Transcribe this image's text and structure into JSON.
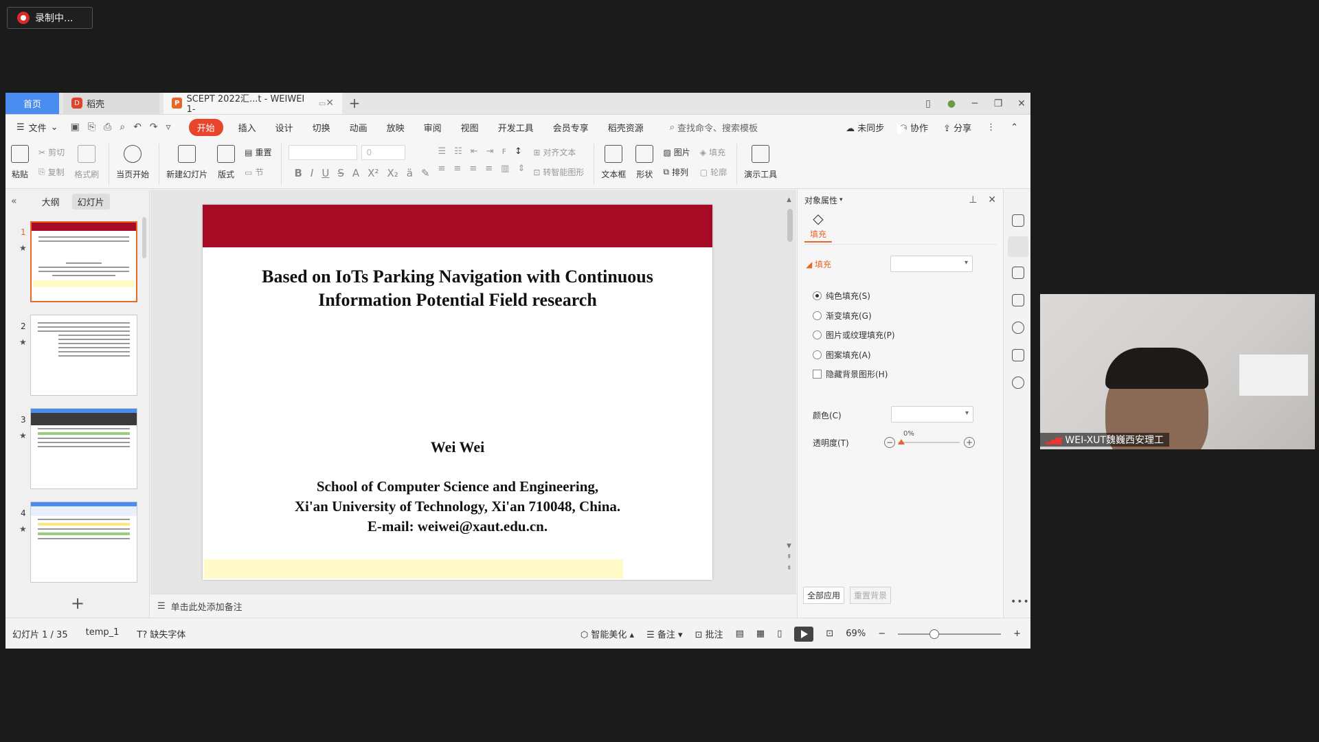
{
  "recording": {
    "label": "录制中..."
  },
  "tabs": {
    "home": "首页",
    "daoke": "稻壳",
    "doc": "SCEPT 2022汇...t - WEIWEI 1-",
    "add": "+"
  },
  "menu": {
    "file": "文件",
    "items": [
      "开始",
      "插入",
      "设计",
      "切换",
      "动画",
      "放映",
      "审阅",
      "视图",
      "开发工具",
      "会员专享",
      "稻壳资源"
    ],
    "active": "开始",
    "search": "查找命令、搜索模板",
    "unsynced": "未同步",
    "collab": "协作",
    "share": "分享"
  },
  "ribbon": {
    "paste": "粘贴",
    "cut": "剪切",
    "copy": "复制",
    "format_painter": "格式刷",
    "from_current": "当页开始",
    "new_slide": "新建幻灯片",
    "layout": "版式",
    "reset": "重置",
    "section": "节",
    "font_size": "0",
    "align_text": "对齐文本",
    "smart_graphic": "转智能图形",
    "textbox": "文本框",
    "shape": "形状",
    "picture": "图片",
    "arrange": "排列",
    "fill": "填充",
    "outline": "轮廓",
    "presentation_tools": "演示工具"
  },
  "leftpane": {
    "outline": "大纲",
    "slides": "幻灯片",
    "thumbs": [
      "1",
      "2",
      "3",
      "4"
    ]
  },
  "slide": {
    "title": "Based on IoTs Parking Navigation with Continuous Information Potential Field research",
    "author": "Wei Wei",
    "affil1": "School of Computer Science and Engineering,",
    "affil2": "Xi'an University of Technology, Xi'an 710048, China.",
    "affil3": "E-mail: weiwei@xaut.edu.cn."
  },
  "notes": {
    "placeholder": "单击此处添加备注"
  },
  "props": {
    "header": "对象属性",
    "tab": "填充",
    "section": "填充",
    "options": [
      "纯色填充(S)",
      "渐变填充(G)",
      "图片或纹理填充(P)",
      "图案填充(A)"
    ],
    "selected_option": "纯色填充(S)",
    "hide_bg": "隐藏背景图形(H)",
    "color": "颜色(C)",
    "transparency": "透明度(T)",
    "transparency_value": "0%",
    "apply_all": "全部应用",
    "reset_bg": "重置背景"
  },
  "status": {
    "slide_of": "幻灯片 1 / 35",
    "template": "temp_1",
    "missing_font": "缺失字体",
    "beautify": "智能美化",
    "notes": "备注",
    "comments": "批注",
    "zoom": "69%"
  },
  "webcam": {
    "name": "WEI-XUT魏巍西安理工"
  },
  "colors": {
    "accent": "#e8662a",
    "banner": "#a60a25",
    "home_tab": "#4a8cf0",
    "active_menu": "#e8452c"
  }
}
